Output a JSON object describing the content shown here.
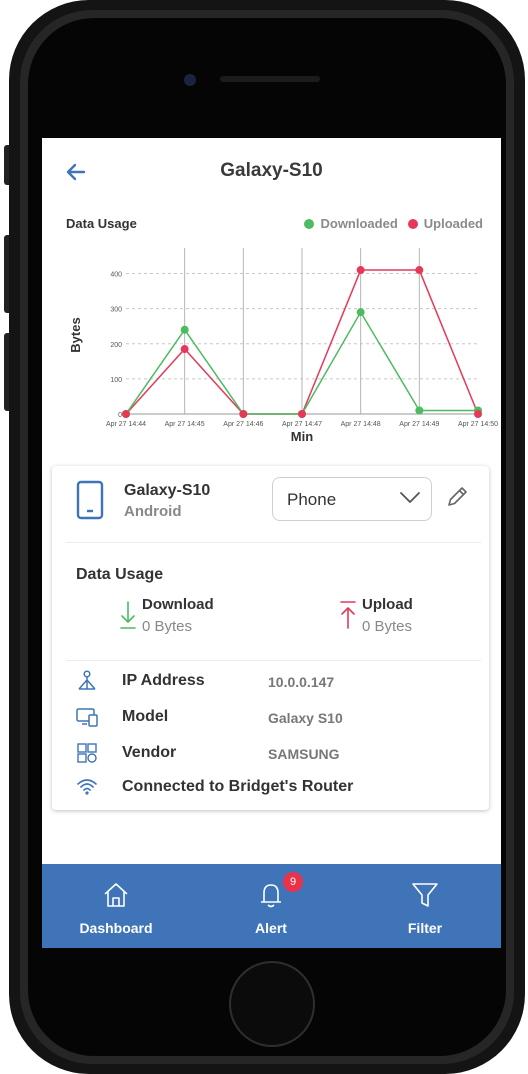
{
  "header": {
    "title": "Galaxy-S10"
  },
  "chart_header": {
    "title": "Data Usage",
    "legend": [
      {
        "label": "Downloaded",
        "color": "#4dbb5f"
      },
      {
        "label": "Uploaded",
        "color": "#e6395a"
      }
    ]
  },
  "chart_data": {
    "type": "line",
    "categories": [
      "Apr 27 14:44",
      "Apr 27 14:45",
      "Apr 27 14:46",
      "Apr 27 14:47",
      "Apr 27 14:48",
      "Apr 27 14:49",
      "Apr 27 14:50"
    ],
    "series": [
      {
        "name": "Downloaded",
        "color": "#4dbb5f",
        "values": [
          0,
          240,
          0,
          0,
          290,
          10,
          10
        ]
      },
      {
        "name": "Uploaded",
        "color": "#e6395a",
        "values": [
          0,
          185,
          0,
          0,
          410,
          410,
          0
        ]
      }
    ],
    "xlabel": "Min",
    "ylabel": "Bytes",
    "ylim": [
      0,
      450
    ],
    "yticks": [
      0,
      100,
      200,
      300,
      400
    ],
    "grid": true,
    "legend_placement": "top-right"
  },
  "device": {
    "name": "Galaxy-S10",
    "os": "Android",
    "type_value": "Phone",
    "icon": "phone-icon"
  },
  "usage": {
    "title": "Data Usage",
    "download_label": "Download",
    "download_value": "0 Bytes",
    "upload_label": "Upload",
    "upload_value": "0 Bytes",
    "download_color": "#4dbb5f",
    "upload_color": "#e6395a"
  },
  "info": {
    "ip_label": "IP Address",
    "ip_value": "10.0.0.147",
    "model_label": "Model",
    "model_value": "Galaxy S10",
    "vendor_label": "Vendor",
    "vendor_value": "SAMSUNG",
    "connection_label": "Connected to Bridget's Router"
  },
  "nav": {
    "dashboard": "Dashboard",
    "alert": "Alert",
    "alert_badge": "9",
    "filter": "Filter"
  },
  "colors": {
    "accent": "#3f74b8",
    "frame": "#1a1a1a"
  }
}
